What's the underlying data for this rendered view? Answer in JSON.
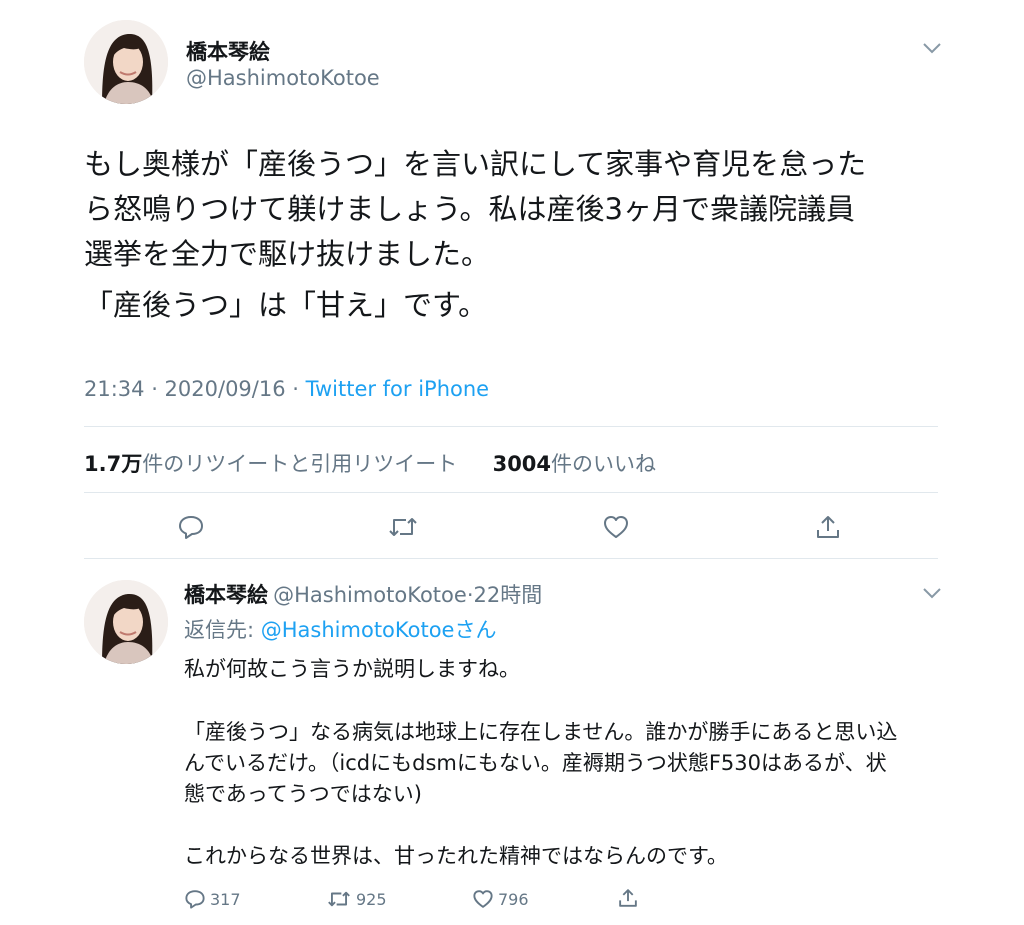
{
  "tweet": {
    "display_name": "橋本琴絵",
    "handle": "@HashimotoKotoe",
    "body_line1": "もし奥様が「産後うつ」を言い訳にして家事や育児を怠った",
    "body_line2": "ら怒鳴りつけて躾けましょう。私は産後3ヶ月で衆議院議員",
    "body_line3": "選挙を全力で駆け抜けました。",
    "body_line4": "「産後うつ」は「甘え」です。",
    "time": "21:34 · 2020/09/16 · ",
    "source": "Twitter for iPhone",
    "retweet_count": "1.7万",
    "retweet_label": "件のリツイートと引用リツイート",
    "like_count": "3004",
    "like_label": "件のいいね"
  },
  "reply": {
    "display_name": "橋本琴絵",
    "handle": "@HashimotoKotoe",
    "time_ago": "·22時間",
    "reply_to_prefix": "返信先: ",
    "reply_to_handle": "@HashimotoKotoeさん",
    "line1": "私が何故こう言うか説明しますね。",
    "line2": "「産後うつ」なる病気は地球上に存在しません。誰かが勝手にあると思い込",
    "line3": "んでいるだけ。（icdにもdsmにもない。産褥期うつ状態F530はあるが、状",
    "line4": "態であってうつではない)",
    "line5": "これからなる世界は、甘ったれた精神ではならんのです。",
    "replies": "317",
    "retweets": "925",
    "likes": "796"
  },
  "colors": {
    "accent": "#1da1f2",
    "secondary_text": "#657786",
    "divider": "#e1e8ed"
  }
}
